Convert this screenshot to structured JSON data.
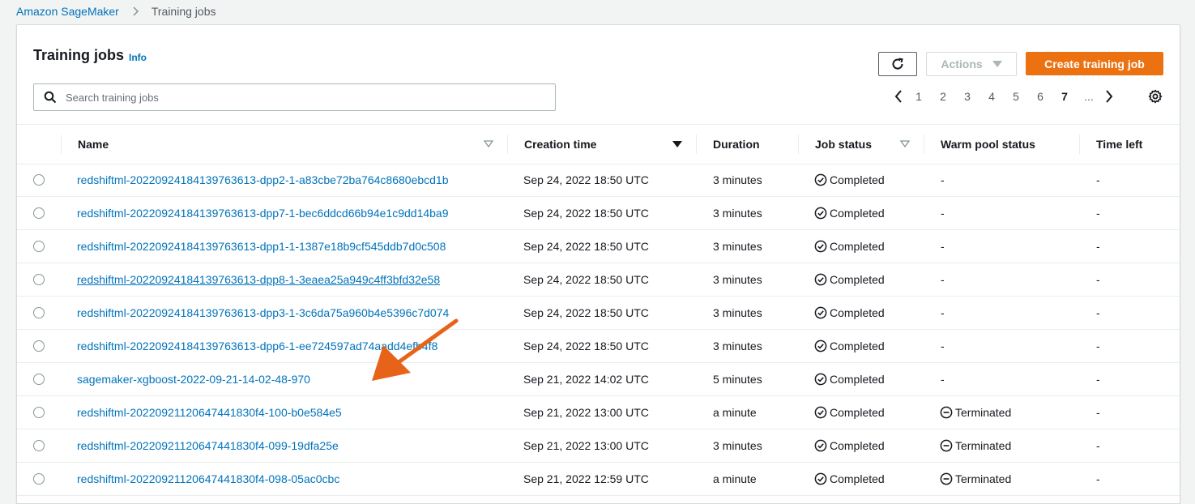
{
  "breadcrumb": {
    "root": "Amazon SageMaker",
    "current": "Training jobs"
  },
  "header": {
    "title": "Training jobs",
    "info": "Info",
    "refresh_icon": "refresh-icon",
    "actions_label": "Actions",
    "create_label": "Create training job"
  },
  "search": {
    "placeholder": "Search training jobs",
    "value": ""
  },
  "pagination": {
    "pages": [
      "1",
      "2",
      "3",
      "4",
      "5",
      "6",
      "7",
      "..."
    ],
    "current": "7"
  },
  "columns": {
    "name": "Name",
    "creation_time": "Creation time",
    "duration": "Duration",
    "job_status": "Job status",
    "warm_pool_status": "Warm pool status",
    "time_left": "Time left"
  },
  "rows": [
    {
      "name": "redshiftml-20220924184139763613-dpp2-1-a83cbe72ba764c8680ebcd1b",
      "creation_time": "Sep 24, 2022 18:50 UTC",
      "duration": "3 minutes",
      "job_status": "Completed",
      "warm_pool_status": "-",
      "time_left": "-"
    },
    {
      "name": "redshiftml-20220924184139763613-dpp7-1-bec6ddcd66b94e1c9dd14ba9",
      "creation_time": "Sep 24, 2022 18:50 UTC",
      "duration": "3 minutes",
      "job_status": "Completed",
      "warm_pool_status": "-",
      "time_left": "-"
    },
    {
      "name": "redshiftml-20220924184139763613-dpp1-1-1387e18b9cf545ddb7d0c508",
      "creation_time": "Sep 24, 2022 18:50 UTC",
      "duration": "3 minutes",
      "job_status": "Completed",
      "warm_pool_status": "-",
      "time_left": "-"
    },
    {
      "name": "redshiftml-20220924184139763613-dpp8-1-3eaea25a949c4ff3bfd32e58",
      "creation_time": "Sep 24, 2022 18:50 UTC",
      "duration": "3 minutes",
      "job_status": "Completed",
      "warm_pool_status": "-",
      "time_left": "-"
    },
    {
      "name": "redshiftml-20220924184139763613-dpp3-1-3c6da75a960b4e5396c7d074",
      "creation_time": "Sep 24, 2022 18:50 UTC",
      "duration": "3 minutes",
      "job_status": "Completed",
      "warm_pool_status": "-",
      "time_left": "-"
    },
    {
      "name": "redshiftml-20220924184139763613-dpp6-1-ee724597ad74aadd4efb4f8",
      "creation_time": "Sep 24, 2022 18:50 UTC",
      "duration": "3 minutes",
      "job_status": "Completed",
      "warm_pool_status": "-",
      "time_left": "-"
    },
    {
      "name": "sagemaker-xgboost-2022-09-21-14-02-48-970",
      "creation_time": "Sep 21, 2022 14:02 UTC",
      "duration": "5 minutes",
      "job_status": "Completed",
      "warm_pool_status": "-",
      "time_left": "-"
    },
    {
      "name": "redshiftml-20220921120647441830f4-100-b0e584e5",
      "creation_time": "Sep 21, 2022 13:00 UTC",
      "duration": "a minute",
      "job_status": "Completed",
      "warm_pool_status": "Terminated",
      "time_left": "-"
    },
    {
      "name": "redshiftml-20220921120647441830f4-099-19dfa25e",
      "creation_time": "Sep 21, 2022 13:00 UTC",
      "duration": "3 minutes",
      "job_status": "Completed",
      "warm_pool_status": "Terminated",
      "time_left": "-"
    },
    {
      "name": "redshiftml-20220921120647441830f4-098-05ac0cbc",
      "creation_time": "Sep 21, 2022 12:59 UTC",
      "duration": "a minute",
      "job_status": "Completed",
      "warm_pool_status": "Terminated",
      "time_left": "-"
    }
  ],
  "colors": {
    "link": "#0073bb",
    "primary": "#ec7211",
    "annotation": "#e8631a"
  }
}
